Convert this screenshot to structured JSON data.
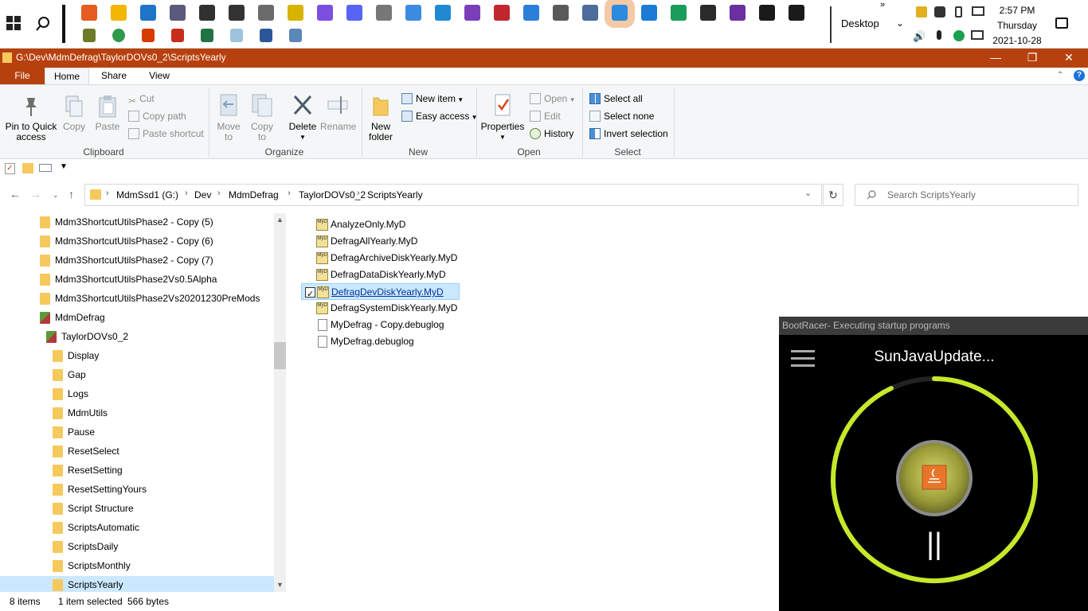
{
  "taskbar": {
    "desktop_label": "Desktop",
    "time": "2:57 PM",
    "day": "Thursday",
    "date": "2021-10-28",
    "pinned_row1": [
      "firefox-icon",
      "file-explorer-icon",
      "outlook-icon",
      "app-icon",
      "app-icon",
      "app-icon",
      "gimp-icon",
      "app-icon",
      "messenger-icon",
      "discord-icon",
      "clock-icon",
      "app-icon",
      "vscode-icon",
      "visual-studio-icon",
      "app-icon",
      "app-icon",
      "gear-icon",
      "app-icon",
      "app-icon",
      "todo-icon",
      "app-icon",
      "app-icon",
      "app-icon",
      "terminal-icon",
      "terminal-icon"
    ],
    "pinned_row2": [
      "app-icon",
      "chrome-icon",
      "office-icon",
      "acrobat-icon",
      "excel-icon",
      "notepad-icon",
      "word-icon",
      "document-icon"
    ]
  },
  "window": {
    "title": "G:\\Dev\\MdmDefrag\\TaylorDOVs0_2\\ScriptsYearly"
  },
  "ribbon_tabs": [
    "File",
    "Home",
    "Share",
    "View"
  ],
  "ribbon": {
    "clipboard": {
      "group_label": "Clipboard",
      "pin_to_quick_access": [
        "Pin to Quick",
        "access"
      ],
      "copy": "Copy",
      "paste": "Paste",
      "cut": "Cut",
      "copy_path": "Copy path",
      "paste_shortcut": "Paste shortcut"
    },
    "organize": {
      "group_label": "Organize",
      "move_to": [
        "Move",
        "to"
      ],
      "copy_to": [
        "Copy",
        "to"
      ],
      "delete": "Delete",
      "rename": "Rename"
    },
    "new": {
      "group_label": "New",
      "new_folder": [
        "New",
        "folder"
      ],
      "new_item": "New item",
      "easy_access": "Easy access"
    },
    "open": {
      "group_label": "Open",
      "properties": "Properties",
      "open": "Open",
      "edit": "Edit",
      "history": "History"
    },
    "select": {
      "group_label": "Select",
      "select_all": "Select all",
      "select_none": "Select none",
      "invert_selection": "Invert selection"
    }
  },
  "address": {
    "crumbs": [
      "MdmSsd1 (G:)",
      "Dev",
      "MdmDefrag",
      "TaylorDOVs0_2",
      "ScriptsYearly"
    ],
    "search_placeholder": "Search ScriptsYearly"
  },
  "nav_tree": [
    {
      "label": "Mdm3ShortcutUtilsPhase2 - Copy (5)",
      "indent": 0,
      "icon": "folder"
    },
    {
      "label": "Mdm3ShortcutUtilsPhase2 - Copy (6)",
      "indent": 0,
      "icon": "folder"
    },
    {
      "label": "Mdm3ShortcutUtilsPhase2 - Copy (7)",
      "indent": 0,
      "icon": "folder"
    },
    {
      "label": "Mdm3ShortcutUtilsPhase2Vs0.5Alpha",
      "indent": 0,
      "icon": "folder"
    },
    {
      "label": "Mdm3ShortcutUtilsPhase2Vs20201230PreMods",
      "indent": 0,
      "icon": "folder"
    },
    {
      "label": "MdmDefrag",
      "indent": 0,
      "icon": "git-folder"
    },
    {
      "label": "TaylorDOVs0_2",
      "indent": 1,
      "icon": "git-folder"
    },
    {
      "label": "Display",
      "indent": 2,
      "icon": "folder"
    },
    {
      "label": "Gap",
      "indent": 2,
      "icon": "folder"
    },
    {
      "label": "Logs",
      "indent": 2,
      "icon": "folder"
    },
    {
      "label": "MdmUtils",
      "indent": 2,
      "icon": "folder"
    },
    {
      "label": "Pause",
      "indent": 2,
      "icon": "folder"
    },
    {
      "label": "ResetSelect",
      "indent": 2,
      "icon": "folder"
    },
    {
      "label": "ResetSetting",
      "indent": 2,
      "icon": "folder"
    },
    {
      "label": "ResetSettingYours",
      "indent": 2,
      "icon": "folder"
    },
    {
      "label": "Script Structure",
      "indent": 2,
      "icon": "folder"
    },
    {
      "label": "ScriptsAutomatic",
      "indent": 2,
      "icon": "folder"
    },
    {
      "label": "ScriptsDaily",
      "indent": 2,
      "icon": "folder"
    },
    {
      "label": "ScriptsMonthly",
      "indent": 2,
      "icon": "folder"
    },
    {
      "label": "ScriptsYearly",
      "indent": 2,
      "icon": "folder",
      "selected": true
    }
  ],
  "files": [
    {
      "name": "AnalyzeOnly.MyD",
      "type": "myd"
    },
    {
      "name": "DefragAllYearly.MyD",
      "type": "myd"
    },
    {
      "name": "DefragArchiveDiskYearly.MyD",
      "type": "myd"
    },
    {
      "name": "DefragDataDiskYearly.MyD",
      "type": "myd"
    },
    {
      "name": "DefragDevDiskYearly.MyD",
      "type": "myd",
      "selected": true
    },
    {
      "name": "DefragSystemDiskYearly.MyD",
      "type": "myd"
    },
    {
      "name": "MyDefrag - Copy.debuglog",
      "type": "text"
    },
    {
      "name": "MyDefrag.debuglog",
      "type": "text"
    }
  ],
  "file_icon_text": "MyD",
  "status": {
    "items": "8 items",
    "selected": "1 item selected",
    "size": "566 bytes"
  },
  "bootracer": {
    "title": "BootRacer- Executing startup programs",
    "task": "SunJavaUpdate...",
    "progress": 0.93,
    "pause_glyph": "||"
  },
  "colors": {
    "accent": "#b7410e",
    "selection": "#cce8ff",
    "folder": "#f6c95d",
    "ring": "#c5e82a"
  }
}
